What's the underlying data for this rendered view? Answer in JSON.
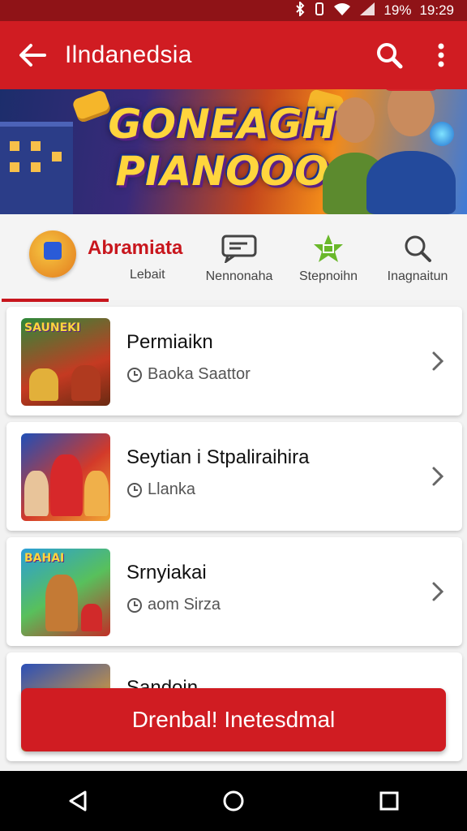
{
  "status_bar": {
    "battery": "19%",
    "time": "19:29"
  },
  "app_bar": {
    "title": "Ilndanedsia"
  },
  "banner": {
    "title_line1": "GONEAGH",
    "title_line2": "PIANOOO"
  },
  "categories": {
    "active": {
      "name": "Abramiata",
      "sub": "Lebait"
    },
    "items": [
      {
        "label": "Nennonaha",
        "icon": "chat-icon"
      },
      {
        "label": "Stepnoihn",
        "icon": "star-icon"
      },
      {
        "label": "Inagnaitun",
        "icon": "search-icon"
      }
    ]
  },
  "list": [
    {
      "title": "Permiaikn",
      "meta": "Baoka Saattor",
      "thumb_label": "SAUNEKI"
    },
    {
      "title": "Seytian i Stpaliraihira",
      "meta": "Llanka",
      "thumb_label": ""
    },
    {
      "title": "Srnyiakai",
      "meta": "aom Sirza",
      "thumb_label": "BAHAI"
    },
    {
      "title": "Sandoin",
      "meta": "",
      "thumb_label": ""
    }
  ],
  "cta": {
    "label": "Drenbal! Inetesdmal"
  },
  "colors": {
    "primary": "#d01c22",
    "status": "#8f1317"
  }
}
